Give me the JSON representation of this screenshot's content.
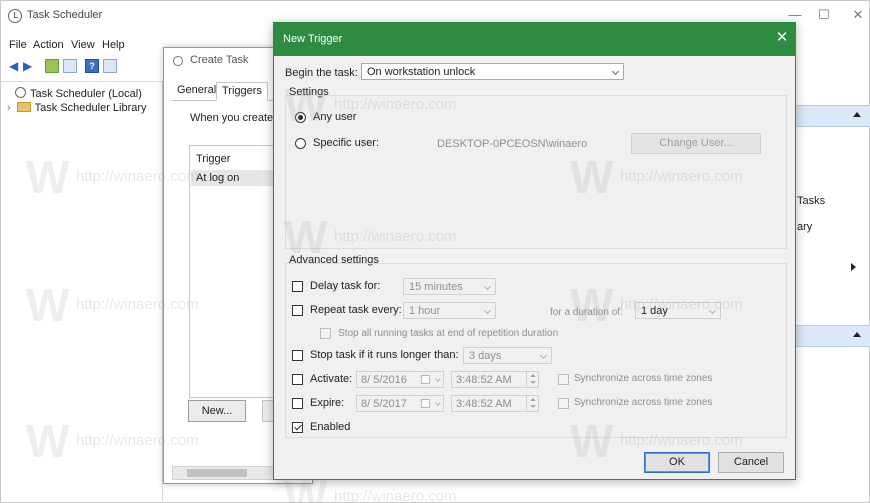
{
  "main": {
    "title": "Task Scheduler",
    "window_controls": {
      "minimize": "—",
      "maximize": "☐",
      "close": "✕"
    },
    "menu": [
      "File",
      "Action",
      "View",
      "Help"
    ],
    "toolbar_icons": [
      "back-arrow-icon",
      "forward-arrow-icon",
      "up-folder-icon",
      "show-hide-console-tree-icon",
      "help-icon",
      "show-action-pane-icon"
    ],
    "tree": {
      "root": "Task Scheduler (Local)",
      "expander": "›",
      "library": "Task Scheduler Library"
    },
    "right_panel": {
      "text_tasks": "Tasks",
      "text_library": "ary"
    }
  },
  "create_task": {
    "title": "Create Task",
    "tabs": [
      "General",
      "Triggers"
    ],
    "when_text": "When you create a",
    "list_header": "Trigger",
    "list_row": "At log on",
    "new_button": "New..."
  },
  "new_trigger": {
    "title": "New Trigger",
    "close": "✕",
    "begin_label": "Begin the task:",
    "begin_value": "On workstation unlock",
    "settings_label": "Settings",
    "any_user": "Any user",
    "specific_user": "Specific user:",
    "user_name": "DESKTOP-0PCEOSN\\winaero",
    "change_user": "Change User...",
    "advanced_label": "Advanced settings",
    "delay_label": "Delay task for:",
    "delay_value": "15 minutes",
    "repeat_label": "Repeat task every:",
    "repeat_value": "1 hour",
    "duration_label": "for a duration of:",
    "duration_value": "1 day",
    "stop_all_label": "Stop all running tasks at end of repetition duration",
    "stop_if_label": "Stop task if it runs longer than:",
    "stop_if_value": "3 days",
    "activate_label": "Activate:",
    "activate_date": "8/ 5/2016",
    "activate_time": "3:48:52 AM",
    "sync_label": "Synchronize across time zones",
    "expire_label": "Expire:",
    "expire_date": "8/ 5/2017",
    "expire_time": "3:48:52 AM",
    "enabled_label": "Enabled",
    "ok": "OK",
    "cancel": "Cancel"
  },
  "watermark": {
    "letter": "W",
    "url": "http://winaero.com"
  },
  "colors": {
    "title_bar": "#2d8c41",
    "dialog_bg": "#f0f0f0",
    "selection_blue": "#dbe8f7"
  }
}
